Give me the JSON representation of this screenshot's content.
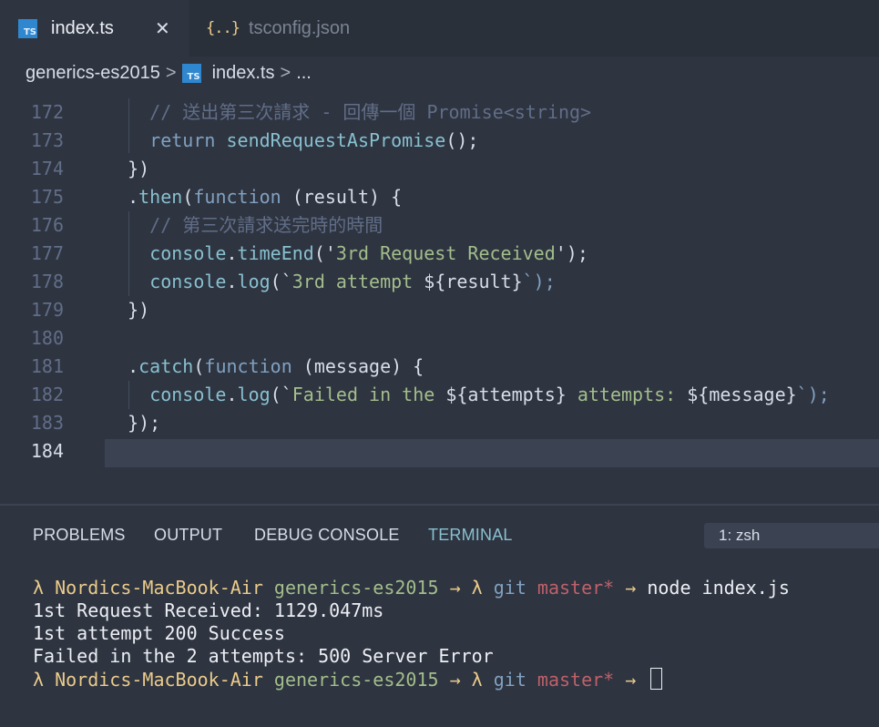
{
  "tabs": [
    {
      "icon": "typescript-icon",
      "label": "index.ts",
      "close": "✕",
      "active": true
    },
    {
      "icon": "json-braces-icon",
      "label": "tsconfig.json",
      "active": false
    }
  ],
  "json_icon_glyph": "{..}",
  "ts_icon_glyph": "TS",
  "breadcrumb": {
    "folder": "generics-es2015",
    "sep": ">",
    "file": "index.ts",
    "more": "..."
  },
  "editor": {
    "lines": [
      {
        "num": "172",
        "tokens": [
          {
            "t": "  // 送出第三次請求 - 回傳一個 Promise<string>",
            "c": "comment"
          }
        ]
      },
      {
        "num": "173",
        "tokens": [
          {
            "t": "  ",
            "c": "plain"
          },
          {
            "t": "return",
            "c": "kw"
          },
          {
            "t": " ",
            "c": "plain"
          },
          {
            "t": "sendRequestAsPromise",
            "c": "fn"
          },
          {
            "t": "();",
            "c": "plain"
          }
        ]
      },
      {
        "num": "174",
        "tokens": [
          {
            "t": "})",
            "c": "plain"
          }
        ]
      },
      {
        "num": "175",
        "tokens": [
          {
            "t": ".",
            "c": "plain"
          },
          {
            "t": "then",
            "c": "fn"
          },
          {
            "t": "(",
            "c": "plain"
          },
          {
            "t": "function",
            "c": "kw"
          },
          {
            "t": " (result) {",
            "c": "plain"
          }
        ]
      },
      {
        "num": "176",
        "tokens": [
          {
            "t": "  // 第三次請求送完時的時間",
            "c": "comment"
          }
        ]
      },
      {
        "num": "177",
        "tokens": [
          {
            "t": "  ",
            "c": "plain"
          },
          {
            "t": "console",
            "c": "fn"
          },
          {
            "t": ".",
            "c": "plain"
          },
          {
            "t": "timeEnd",
            "c": "fn"
          },
          {
            "t": "('",
            "c": "plain"
          },
          {
            "t": "3rd Request Received",
            "c": "str"
          },
          {
            "t": "');",
            "c": "plain"
          }
        ]
      },
      {
        "num": "178",
        "tokens": [
          {
            "t": "  ",
            "c": "plain"
          },
          {
            "t": "console",
            "c": "fn"
          },
          {
            "t": ".",
            "c": "plain"
          },
          {
            "t": "log",
            "c": "fn"
          },
          {
            "t": "(`",
            "c": "plain"
          },
          {
            "t": "3rd attempt ",
            "c": "str"
          },
          {
            "t": "${result}",
            "c": "plain"
          },
          {
            "t": "`);",
            "c": "kw"
          }
        ]
      },
      {
        "num": "179",
        "tokens": [
          {
            "t": "})",
            "c": "plain"
          }
        ]
      },
      {
        "num": "180",
        "tokens": []
      },
      {
        "num": "181",
        "tokens": [
          {
            "t": ".",
            "c": "plain"
          },
          {
            "t": "catch",
            "c": "fn"
          },
          {
            "t": "(",
            "c": "plain"
          },
          {
            "t": "function",
            "c": "kw"
          },
          {
            "t": " (message) {",
            "c": "plain"
          }
        ]
      },
      {
        "num": "182",
        "tokens": [
          {
            "t": "  ",
            "c": "plain"
          },
          {
            "t": "console",
            "c": "fn"
          },
          {
            "t": ".",
            "c": "plain"
          },
          {
            "t": "log",
            "c": "fn"
          },
          {
            "t": "(`",
            "c": "plain"
          },
          {
            "t": "Failed in the ",
            "c": "str"
          },
          {
            "t": "${attempts}",
            "c": "plain"
          },
          {
            "t": " attempts: ",
            "c": "str"
          },
          {
            "t": "${message}",
            "c": "plain"
          },
          {
            "t": "`);",
            "c": "kw"
          }
        ]
      },
      {
        "num": "183",
        "tokens": [
          {
            "t": "});",
            "c": "plain"
          }
        ]
      },
      {
        "num": "184",
        "tokens": [],
        "current": true
      }
    ]
  },
  "panel": {
    "tabs": [
      "PROBLEMS",
      "OUTPUT",
      "DEBUG CONSOLE",
      "TERMINAL"
    ],
    "active_tab": "TERMINAL",
    "terminal_select": "1: zsh"
  },
  "terminal": {
    "lines": [
      [
        {
          "t": "λ Nordics-MacBook-Air ",
          "c": "yellow"
        },
        {
          "t": "generics-es2015",
          "c": "green"
        },
        {
          "t": " → λ ",
          "c": "yellow"
        },
        {
          "t": "git ",
          "c": "blue"
        },
        {
          "t": "master*",
          "c": "red"
        },
        {
          "t": " → ",
          "c": "yellow"
        },
        {
          "t": "node index.js",
          "c": "white"
        }
      ],
      [
        {
          "t": "1st Request Received: 1129.047ms",
          "c": "white"
        }
      ],
      [
        {
          "t": "1st attempt 200 Success",
          "c": "white"
        }
      ],
      [
        {
          "t": "Failed in the 2 attempts: 500 Server Error",
          "c": "white"
        }
      ],
      [
        {
          "t": "λ Nordics-MacBook-Air ",
          "c": "yellow"
        },
        {
          "t": "generics-es2015",
          "c": "green"
        },
        {
          "t": " → λ ",
          "c": "yellow"
        },
        {
          "t": "git ",
          "c": "blue"
        },
        {
          "t": "master*",
          "c": "red"
        },
        {
          "t": " → ",
          "c": "yellow"
        }
      ]
    ]
  },
  "colors": {
    "background": "#2e3440",
    "accent": "#88c0d0",
    "keyword": "#81a1c1",
    "string": "#a3be8c",
    "comment": "#616e88"
  }
}
